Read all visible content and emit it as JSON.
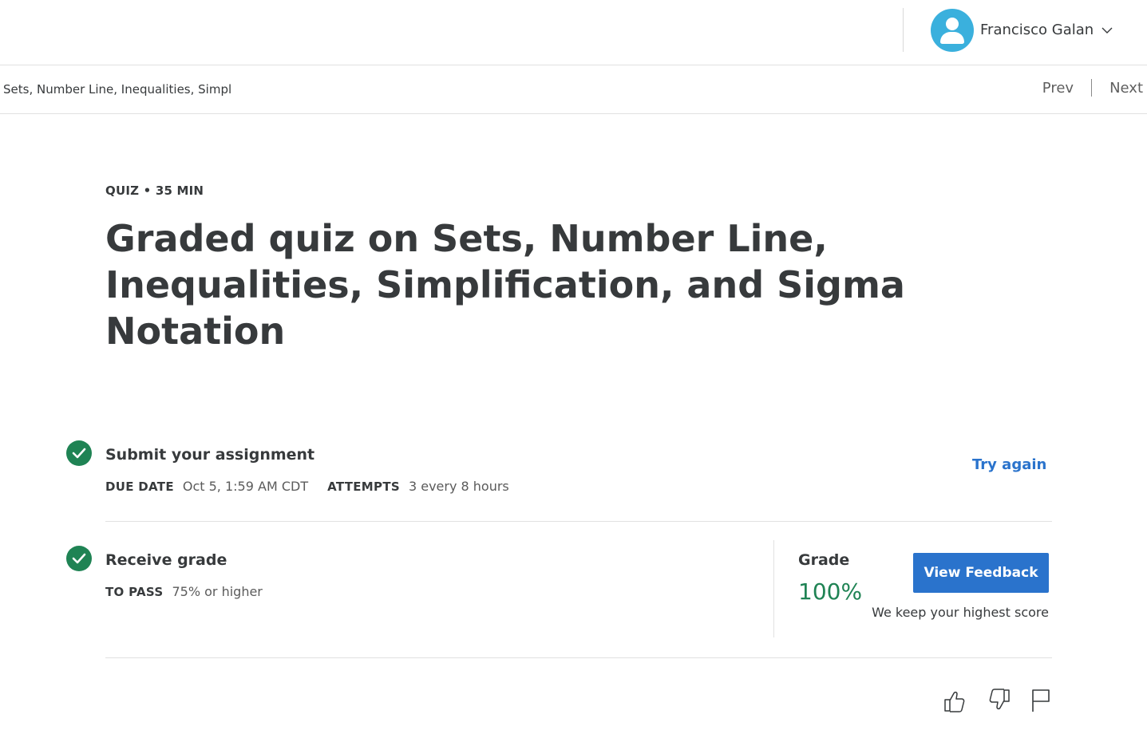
{
  "header": {
    "user_name": "Francisco Galan"
  },
  "nav": {
    "breadcrumb": "Sets, Number Line, Inequalities, Simpl",
    "prev": "Prev",
    "next": "Next"
  },
  "item": {
    "eyebrow": "QUIZ • 35 MIN",
    "title": "Graded quiz on Sets, Number Line, Inequalities, Simplification, and Sigma Notation"
  },
  "submit": {
    "title": "Submit your assignment",
    "due_label": "DUE DATE",
    "due_value": "Oct 5, 1:59 AM CDT",
    "attempts_label": "ATTEMPTS",
    "attempts_value": "3 every 8 hours",
    "try_again": "Try again"
  },
  "receive": {
    "title": "Receive grade",
    "pass_label": "TO PASS",
    "pass_value": "75% or higher",
    "grade_label": "Grade",
    "grade_value": "100%",
    "view_feedback": "View Feedback",
    "note": "We keep your highest score"
  },
  "icons": {
    "like": "thumbs-up-icon",
    "dislike": "thumbs-down-icon",
    "flag": "flag-icon"
  },
  "colors": {
    "accent": "#2a73cc",
    "success": "#1f8354",
    "avatar": "#3ab0dd"
  }
}
